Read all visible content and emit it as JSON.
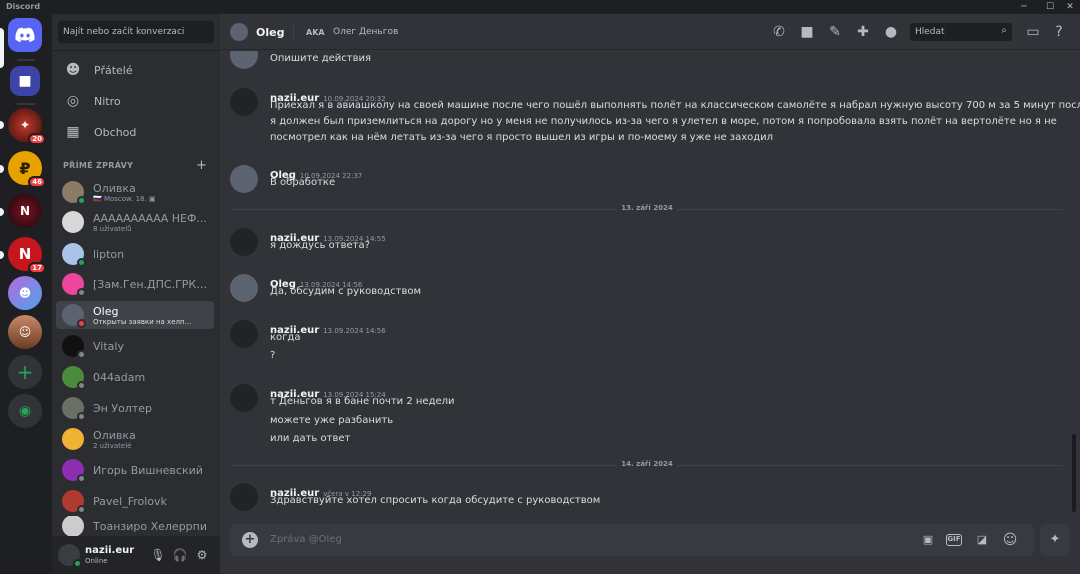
{
  "window": {
    "title": "Discord",
    "minimize": "─",
    "maximize": "☐",
    "close": "✕"
  },
  "guilds": {
    "badges": [
      "20",
      "46",
      "17"
    ],
    "add_symbol": "+"
  },
  "sidebar": {
    "search_placeholder": "Najít nebo začít konverzaci",
    "nav": [
      {
        "label": "Přátelé",
        "icon": "friends-icon"
      },
      {
        "label": "Nitro",
        "icon": "nitro-icon"
      },
      {
        "label": "Obchod",
        "icon": "shop-icon"
      }
    ],
    "dm_header": "PŘÍMÉ ZPRÁVY",
    "dm_add": "+",
    "dms": [
      {
        "name": "Оливка",
        "sub": "🇷🇺 Moscow. 18. ▣"
      },
      {
        "name": "АААААААААА НЕФ...",
        "sub": "8 uživatelů"
      },
      {
        "name": "lipton",
        "sub": ""
      },
      {
        "name": "[Зам.Ген.ДПС.ГРК] К...",
        "sub": ""
      },
      {
        "name": "Oleg",
        "sub": "Открыты заявки на хелп..."
      },
      {
        "name": "Vitaly",
        "sub": ""
      },
      {
        "name": "044adam",
        "sub": ""
      },
      {
        "name": "Эн Уолтер",
        "sub": ""
      },
      {
        "name": "Оливка",
        "sub": "2 uživatelé"
      },
      {
        "name": "Игорь Вишневский",
        "sub": ""
      },
      {
        "name": "Pavel_Frolovk",
        "sub": ""
      },
      {
        "name": "Тоанзиро Хелеррпи",
        "sub": ""
      }
    ]
  },
  "user": {
    "name": "nazii.eur",
    "status": "Online",
    "mic": "🎙",
    "headset": "🎧",
    "settings": "⚙"
  },
  "header": {
    "name": "Oleg",
    "aka": "AKA",
    "nickname": "Олег Деньгов",
    "search": "Hledat"
  },
  "messages": [
    {
      "author": "",
      "time": "",
      "lines": [
        "Опишите действия"
      ]
    },
    {
      "author": "nazii.eur",
      "time": "10.09.2024 20:32",
      "lines": [
        "Приехал я в авиашколу на своей машине после чего пошёл выполнять полёт на классическом самолёте я набрал нужную высоту 700 м за 5 минут после",
        "я должен был приземлиться на дорогу но у меня не получилось из-за чего я улетел в море, потом я попробовала взять полёт на вертолёте но я не",
        "посмотрел как на нём летать из-за чего я просто вышел из игры и по-моему я уже не заходил"
      ]
    },
    {
      "author": "Oleg",
      "time": "10.09.2024 22:37",
      "lines": [
        "В обработке"
      ]
    },
    {
      "author": "nazii.eur",
      "time": "13.09.2024 14:55",
      "lines": [
        "я дождусь ответа?"
      ]
    },
    {
      "author": "Oleg",
      "time": "13.09.2024 14:56",
      "lines": [
        "Да, обсудим с руководством"
      ]
    },
    {
      "author": "nazii.eur",
      "time": "13.09.2024 14:56",
      "lines": [
        "когда",
        "?"
      ]
    },
    {
      "author": "nazii.eur",
      "time": "13.09.2024 15:24",
      "lines": [
        "т Деньгов я  в бане почти 2 недели",
        "можете уже разбанить",
        "или дать ответ"
      ]
    },
    {
      "author": "nazii.eur",
      "time": "včera v 12:29",
      "lines": [
        "Здравствуйте хотел спросить когда обсудите с руководством"
      ]
    }
  ],
  "date_separators": [
    "13. září 2024",
    "14. září 2024"
  ],
  "composer": {
    "placeholder": "Zpráva @Oleg",
    "gif": "GIF"
  }
}
